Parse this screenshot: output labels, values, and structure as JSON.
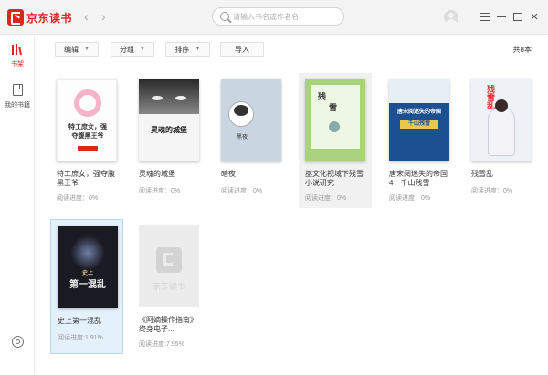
{
  "app": {
    "logo_text": "京东读书"
  },
  "nav": {
    "back": "‹",
    "forward": "›"
  },
  "search": {
    "placeholder": "请输入书名或作者名"
  },
  "sidebar": {
    "items": [
      {
        "label": "书架"
      },
      {
        "label": "我的书籍"
      }
    ]
  },
  "toolbar": {
    "edit": "编辑",
    "group": "分组",
    "sort": "排序",
    "import": "导入",
    "total": "共8本",
    "caret": "▼"
  },
  "books": [
    {
      "title": "特工庶女，强夺腹黑王爷",
      "progress": "阅读进度：0%",
      "cover_text_1": "特工庶女，强",
      "cover_text_2": "夺腹黑王爷",
      "cover_bg": "#fdfdfd"
    },
    {
      "title": "灵魂的城堡",
      "progress": "阅读进度：0%",
      "cover_text_1": "灵魂的城堡",
      "cover_bg": "#f5f5f5"
    },
    {
      "title": "暗夜",
      "progress": "阅读进度：0%",
      "cover_text_1": "黑夜",
      "cover_bg": "#c9d6e2"
    },
    {
      "title": "巫文化视域下残雪小说研究",
      "progress": "阅读进度：0%",
      "cover_text_1": "残",
      "cover_text_2": "雪",
      "cover_bg": "#a9d27f"
    },
    {
      "title": "唐宋阅迷失的帝国4：千山残雪",
      "progress": "阅读进度：0%",
      "cover_text_1": "唐宋阅迷失的帝国",
      "cover_text_2": "千山残雪",
      "cover_bg": "#1d4f93"
    },
    {
      "title": "残雪乱",
      "progress": "阅读进度：0%",
      "cover_text_1": "残雪乱",
      "cover_bg": "#eef2f6"
    },
    {
      "title": "史上第一混乱",
      "progress": "阅读进度:1.91%",
      "cover_text_1": "史上",
      "cover_text_2": "第一混乱",
      "cover_bg": "#1a1a22"
    },
    {
      "title": "《阿嫡操作指南》终身电子...",
      "progress": "阅读进度:7.95%",
      "cover_text_1": "京东读书",
      "cover_bg": "#ececec"
    }
  ]
}
